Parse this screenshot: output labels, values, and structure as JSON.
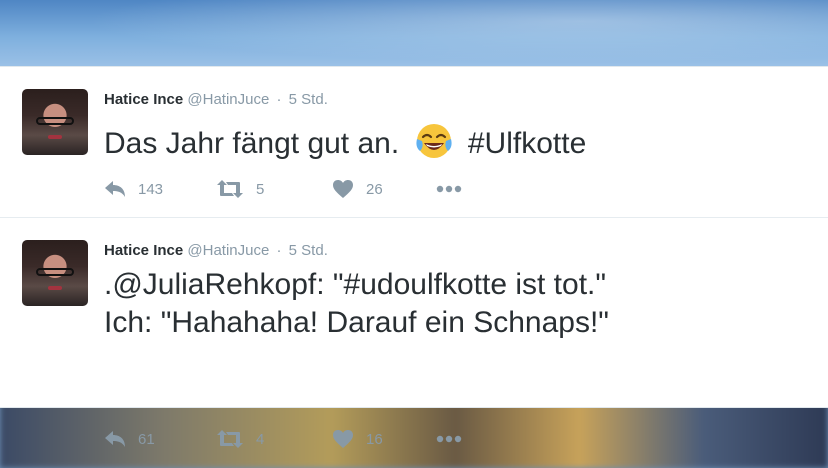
{
  "tweets": [
    {
      "name": "Hatice Ince",
      "handle": "@HatinJuce",
      "time": "5 Std.",
      "text_before": "Das Jahr fängt gut an.",
      "emoji": "face-with-tears-of-joy",
      "text_after": "#Ulfkotte",
      "replies": "143",
      "retweets": "5",
      "likes": "26"
    },
    {
      "name": "Hatice Ince",
      "handle": "@HatinJuce",
      "time": "5 Std.",
      "line1": ".@JuliaRehkopf: \"#udoulfkotte ist tot.\"",
      "line2": "Ich: \"Hahahaha! Darauf ein Schnaps!\"",
      "replies": "61",
      "retweets": "4",
      "likes": "16"
    }
  ],
  "separator": "·",
  "colors": {
    "text": "#292f33",
    "muted": "#8899a6",
    "card": "#ffffff",
    "border": "#e6ecf0"
  }
}
